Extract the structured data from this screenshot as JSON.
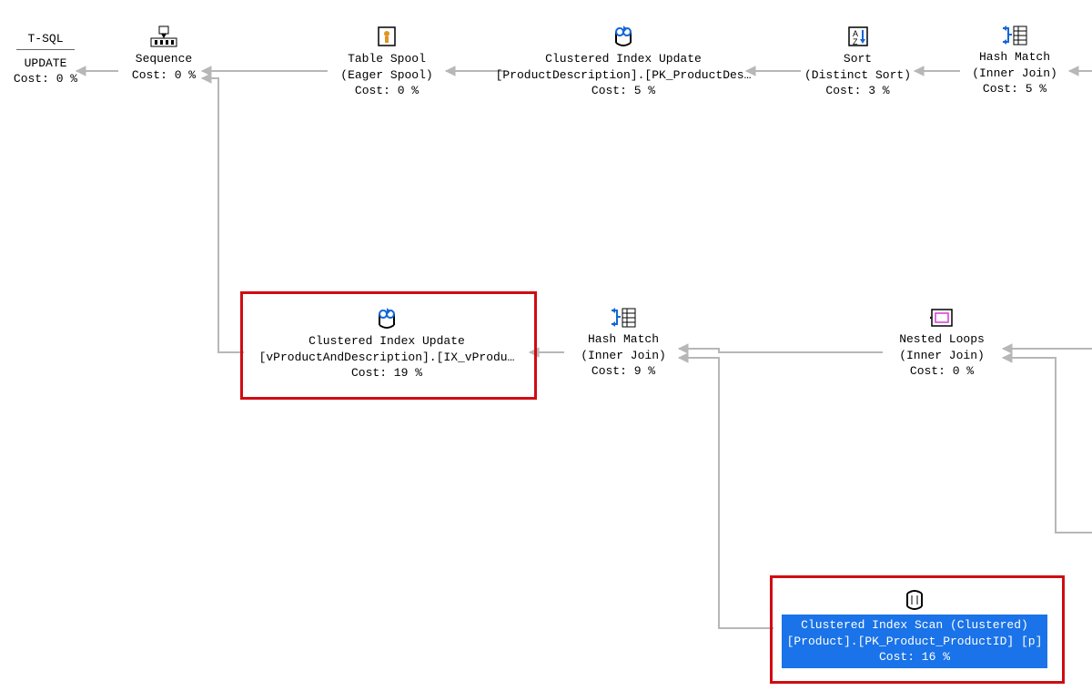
{
  "nodes": {
    "update": {
      "line1": "UPDATE",
      "line2": "Cost: 0 %",
      "header": "T-SQL"
    },
    "sequence": {
      "line1": "Sequence",
      "line2": "Cost: 0 %"
    },
    "tableSpool": {
      "line1": "Table Spool",
      "line2": "(Eager Spool)",
      "line3": "Cost: 0 %"
    },
    "ciu1": {
      "line1": "Clustered Index Update",
      "line2": "[ProductDescription].[PK_ProductDes…",
      "line3": "Cost: 5 %"
    },
    "sort": {
      "line1": "Sort",
      "line2": "(Distinct Sort)",
      "line3": "Cost: 3 %"
    },
    "hash1": {
      "line1": "Hash Match",
      "line2": "(Inner Join)",
      "line3": "Cost: 5 %"
    },
    "ciu2": {
      "line1": "Clustered Index Update",
      "line2": "[vProductAndDescription].[IX_vProdu…",
      "line3": "Cost: 19 %"
    },
    "hash2": {
      "line1": "Hash Match",
      "line2": "(Inner Join)",
      "line3": "Cost: 9 %"
    },
    "nested": {
      "line1": "Nested Loops",
      "line2": "(Inner Join)",
      "line3": "Cost: 0 %"
    },
    "cis": {
      "line1": "Clustered Index Scan (Clustered)",
      "line2": "[Product].[PK_Product_ProductID] [p]",
      "line3": "Cost: 16 %"
    }
  }
}
